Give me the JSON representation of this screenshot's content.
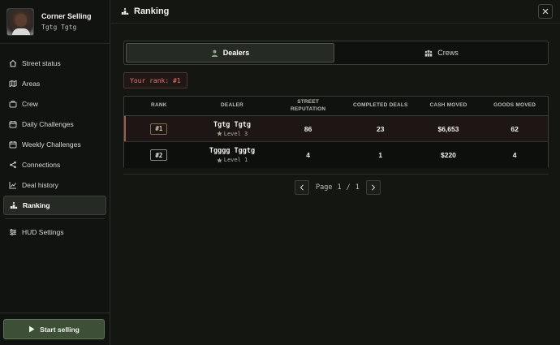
{
  "profile": {
    "name": "Corner Selling",
    "subtitle": "Tgtg Tgtg"
  },
  "nav": [
    {
      "label": "Street status",
      "icon": "home-icon"
    },
    {
      "label": "Areas",
      "icon": "map-icon"
    },
    {
      "label": "Crew",
      "icon": "crew-icon"
    },
    {
      "label": "Daily Challenges",
      "icon": "calendar-icon"
    },
    {
      "label": "Weekly Challenges",
      "icon": "calendar-icon"
    },
    {
      "label": "Connections",
      "icon": "share-icon"
    },
    {
      "label": "Deal history",
      "icon": "chart-icon"
    },
    {
      "label": "Ranking",
      "icon": "ranking-icon",
      "active": true
    },
    {
      "label": "HUD Settings",
      "icon": "sliders-icon"
    }
  ],
  "start_button": "Start selling",
  "header": {
    "title": "Ranking"
  },
  "tabs": [
    {
      "label": "Dealers",
      "icon": "user-icon",
      "active": true
    },
    {
      "label": "Crews",
      "icon": "crew-icon",
      "active": false
    }
  ],
  "your_rank": "Your rank: #1",
  "table": {
    "headers": [
      "RANK",
      "DEALER",
      "STREET\nREPUTATION",
      "COMPLETED DEALS",
      "CASH MOVED",
      "GOODS MOVED"
    ],
    "rows": [
      {
        "rank": "#1",
        "name": "Tgtg Tgtg",
        "level": "Level 3",
        "reputation": "86",
        "deals": "23",
        "cash": "$6,653",
        "goods": "62"
      },
      {
        "rank": "#2",
        "name": "Tgggg Tggtg",
        "level": "Level 1",
        "reputation": "4",
        "deals": "1",
        "cash": "$220",
        "goods": "4"
      }
    ]
  },
  "pagination": {
    "word": "Page",
    "current": "1",
    "sep": "/",
    "total": "1"
  },
  "colors": {
    "accent_red": "#e07e72",
    "button_green": "#3d5037"
  }
}
